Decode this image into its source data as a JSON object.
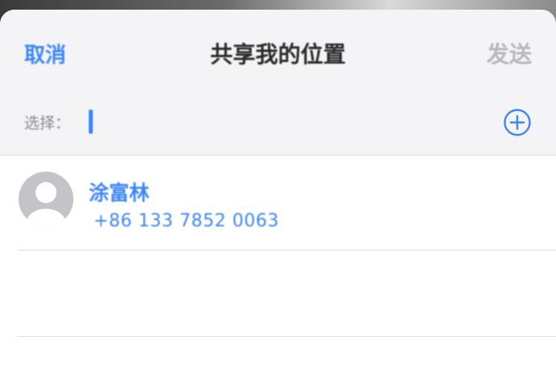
{
  "nav": {
    "cancel_label": "取消",
    "title": "共享我的位置",
    "send_label": "发送"
  },
  "recipient": {
    "label": "选择：",
    "value": ""
  },
  "contacts": [
    {
      "name": "涂富林",
      "phone": "+86 133 7852 0063"
    }
  ],
  "colors": {
    "accent": "#3d86f5",
    "disabled": "#b9b9bd",
    "header_bg": "#f4f4f6",
    "separator": "#dcdcdf"
  },
  "icons": {
    "add": "plus-circle-icon",
    "avatar": "person-silhouette-icon"
  }
}
